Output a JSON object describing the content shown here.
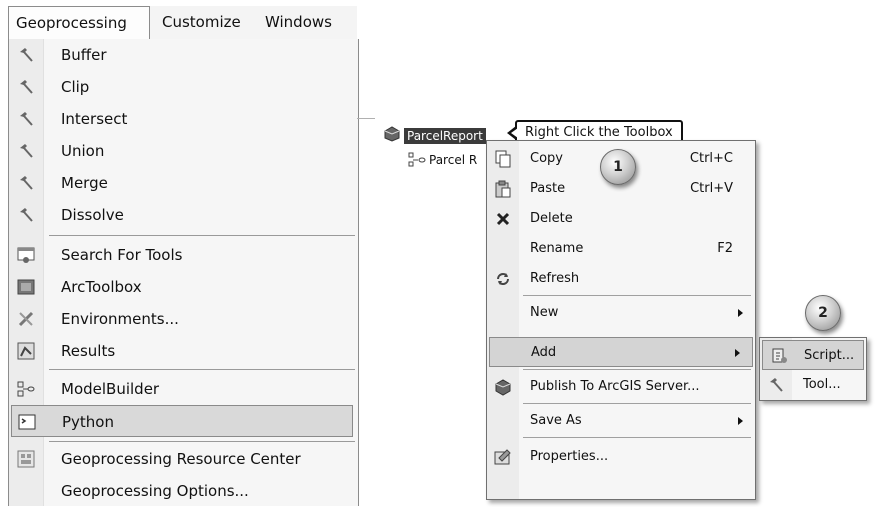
{
  "menubar": {
    "tabs": [
      {
        "label": "Geoprocessing",
        "active": true
      },
      {
        "label": "Customize",
        "active": false
      },
      {
        "label": "Windows",
        "active": false
      }
    ]
  },
  "geoprocessing_menu": {
    "items": [
      {
        "label": "Buffer",
        "icon": "hammer-icon"
      },
      {
        "label": "Clip",
        "icon": "hammer-icon"
      },
      {
        "label": "Intersect",
        "icon": "hammer-icon"
      },
      {
        "label": "Union",
        "icon": "hammer-icon"
      },
      {
        "label": "Merge",
        "icon": "hammer-icon"
      },
      {
        "label": "Dissolve",
        "icon": "hammer-icon"
      },
      {
        "label": "Search For Tools",
        "icon": "search-window-icon"
      },
      {
        "label": "ArcToolbox",
        "icon": "toolbox-icon"
      },
      {
        "label": "Environments...",
        "icon": "tools-icon"
      },
      {
        "label": "Results",
        "icon": "results-icon"
      },
      {
        "label": "ModelBuilder",
        "icon": "model-icon"
      },
      {
        "label": "Python",
        "icon": "python-window-icon",
        "highlighted": true
      },
      {
        "label": "Geoprocessing Resource Center",
        "icon": "resource-center-icon"
      },
      {
        "label": "Geoprocessing Options...",
        "icon": ""
      }
    ]
  },
  "catalog_tree": {
    "toolbox_label": "ParcelReport",
    "model_label": "Parcel R"
  },
  "callout_text": "Right Click the Toolbox",
  "badges": {
    "step1": "1",
    "step2": "2"
  },
  "context_menu": {
    "items": [
      {
        "label": "Copy",
        "shortcut": "Ctrl+C",
        "icon": "copy-icon"
      },
      {
        "label": "Paste",
        "shortcut": "Ctrl+V",
        "icon": "paste-icon"
      },
      {
        "label": "Delete",
        "shortcut": "",
        "icon": "delete-icon"
      },
      {
        "label": "Rename",
        "shortcut": "F2",
        "icon": ""
      },
      {
        "label": "Refresh",
        "shortcut": "",
        "icon": "refresh-icon"
      },
      {
        "label": "New",
        "shortcut": "",
        "icon": "",
        "submenu": true
      },
      {
        "label": "Add",
        "shortcut": "",
        "icon": "",
        "submenu": true,
        "highlighted": true
      },
      {
        "label": "Publish To ArcGIS Server...",
        "shortcut": "",
        "icon": "publish-icon"
      },
      {
        "label": "Save As",
        "shortcut": "",
        "icon": "",
        "submenu": true
      },
      {
        "label": "Properties...",
        "shortcut": "",
        "icon": "properties-icon"
      }
    ]
  },
  "add_submenu": {
    "items": [
      {
        "label": "Script...",
        "icon": "script-icon",
        "highlighted": true
      },
      {
        "label": "Tool...",
        "icon": "hammer-icon"
      }
    ]
  }
}
